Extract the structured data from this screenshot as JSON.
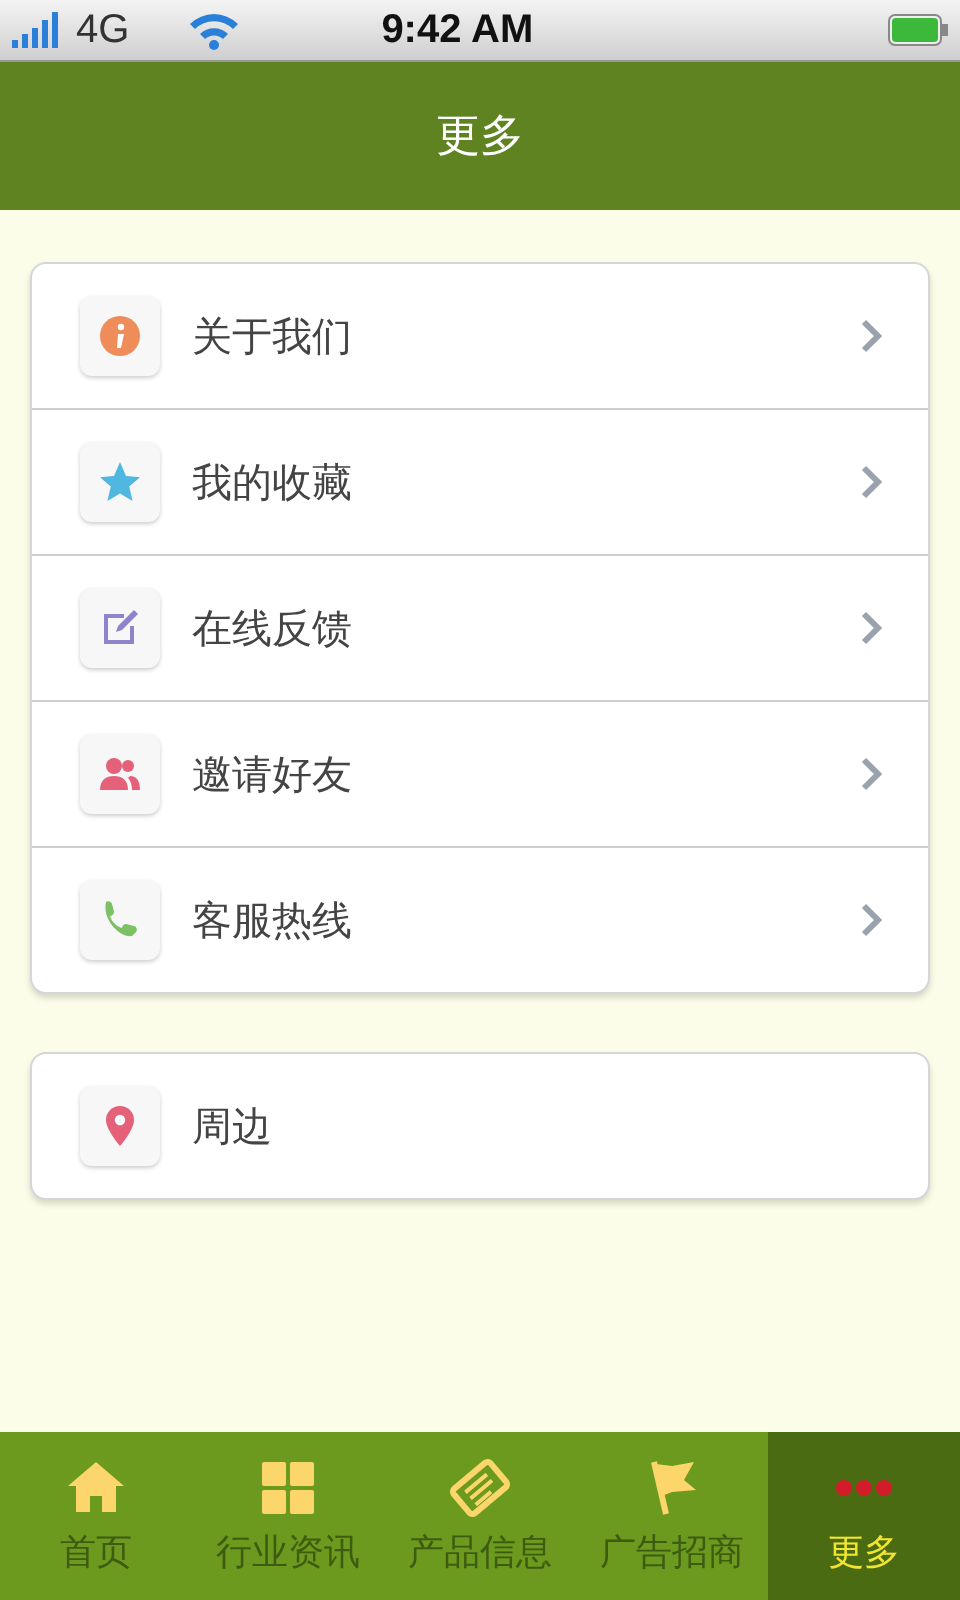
{
  "status_bar": {
    "carrier": "4G",
    "time": "9:42 AM"
  },
  "header": {
    "title": "更多"
  },
  "groups": [
    {
      "items": [
        {
          "label": "关于我们",
          "chevron": true
        },
        {
          "label": "我的收藏",
          "chevron": true
        },
        {
          "label": "在线反馈",
          "chevron": true
        },
        {
          "label": "邀请好友",
          "chevron": true
        },
        {
          "label": "客服热线",
          "chevron": true
        }
      ]
    },
    {
      "items": [
        {
          "label": "周边",
          "chevron": false
        }
      ]
    }
  ],
  "tabs": [
    {
      "label": "首页",
      "selected": false
    },
    {
      "label": "行业资讯",
      "selected": false
    },
    {
      "label": "产品信息",
      "selected": false
    },
    {
      "label": "广告招商",
      "selected": false
    },
    {
      "label": "更多",
      "selected": true
    }
  ]
}
